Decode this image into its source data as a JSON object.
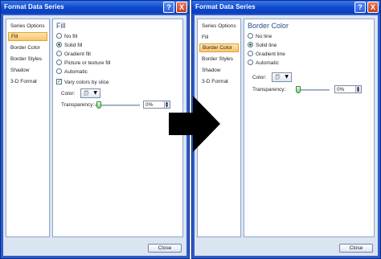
{
  "left_dialog": {
    "title": "Format Data Series",
    "help": "?",
    "close_glyph": "X",
    "nav": [
      "Series Options",
      "Fill",
      "Border Color",
      "Border Styles",
      "Shadow",
      "3-D Format"
    ],
    "selected_nav": "Fill",
    "heading": "Fill",
    "options": [
      {
        "label": "No fill",
        "checked": false
      },
      {
        "label": "Solid fill",
        "checked": true
      },
      {
        "label": "Gradient fill",
        "checked": false
      },
      {
        "label": "Picture or texture fill",
        "checked": false
      },
      {
        "label": "Automatic",
        "checked": false
      }
    ],
    "vary_colors": {
      "label": "Vary colors by slice",
      "checked": true
    },
    "color_label": "Color:",
    "transparency_label": "Transparency:",
    "transparency_value": "0%",
    "close_button": "Close"
  },
  "right_dialog": {
    "title": "Format Data Series",
    "help": "?",
    "close_glyph": "X",
    "nav": [
      "Series Options",
      "Fill",
      "Border Color",
      "Border Styles",
      "Shadow",
      "3-D Format"
    ],
    "selected_nav": "Border Color",
    "heading": "Border Color",
    "options": [
      {
        "label": "No line",
        "checked": false
      },
      {
        "label": "Solid line",
        "checked": true
      },
      {
        "label": "Gradient line",
        "checked": false
      },
      {
        "label": "Automatic",
        "checked": false
      }
    ],
    "color_label": "Color:",
    "transparency_label": "Transparency:",
    "transparency_value": "0%",
    "close_button": "Close"
  },
  "icons": {
    "bucket": "paint-bucket-icon",
    "arrow": "right-arrow-icon"
  },
  "colors": {
    "titlebar": "#0c48cf",
    "dialog_body": "#dbe4f1",
    "selected_tab": "#f9c56c",
    "arrow": "#000000"
  }
}
